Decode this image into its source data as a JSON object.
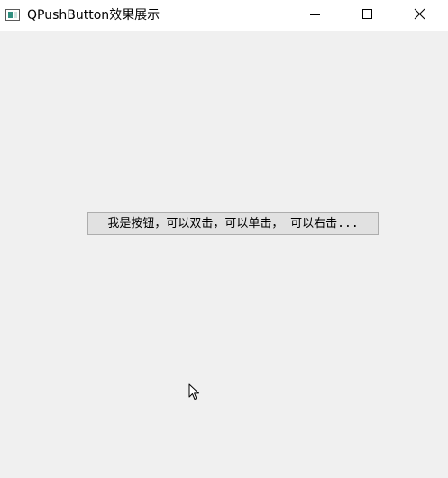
{
  "window": {
    "title": "QPushButton效果展示",
    "app_icon": "window-app-icon",
    "controls": {
      "minimize_icon": "minimize-icon",
      "maximize_icon": "maximize-icon",
      "close_icon": "close-icon"
    }
  },
  "main": {
    "button_label": "我是按钮，可以双击，可以单击， 可以右击..."
  },
  "pointer": {
    "icon": "mouse-pointer-icon"
  }
}
